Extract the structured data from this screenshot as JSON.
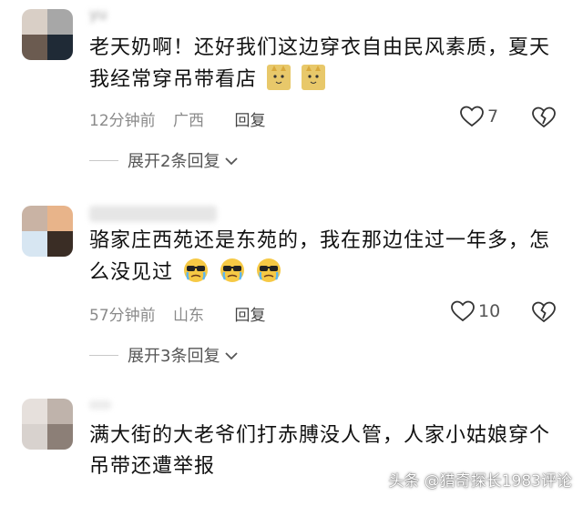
{
  "comments": [
    {
      "username": "yu",
      "text": "老天奶啊！还好我们这边穿衣自由民风素质，夏天我经常穿吊带看店",
      "emoji": "cat-emoji",
      "time": "12分钟前",
      "location": "广西",
      "reply_label": "回复",
      "likes": "7",
      "expand_label": "展开2条回复"
    },
    {
      "username": "",
      "text": "骆家庄西苑还是东苑的，我在那边住过一年多，怎么没见过",
      "emoji": "crying-sunglasses-emoji",
      "time": "57分钟前",
      "location": "山东",
      "reply_label": "回复",
      "likes": "10",
      "expand_label": "展开3条回复"
    },
    {
      "username": "",
      "text": "满大街的大老爷们打赤膊没人管，人家小姑娘穿个吊带还遭举报",
      "time": "",
      "location": "",
      "reply_label": "",
      "likes": ""
    }
  ],
  "watermark": "头条 @猎奇探长1983评论",
  "colors": {
    "text": "#111111",
    "meta": "#8a8a8a",
    "background": "#ffffff"
  }
}
